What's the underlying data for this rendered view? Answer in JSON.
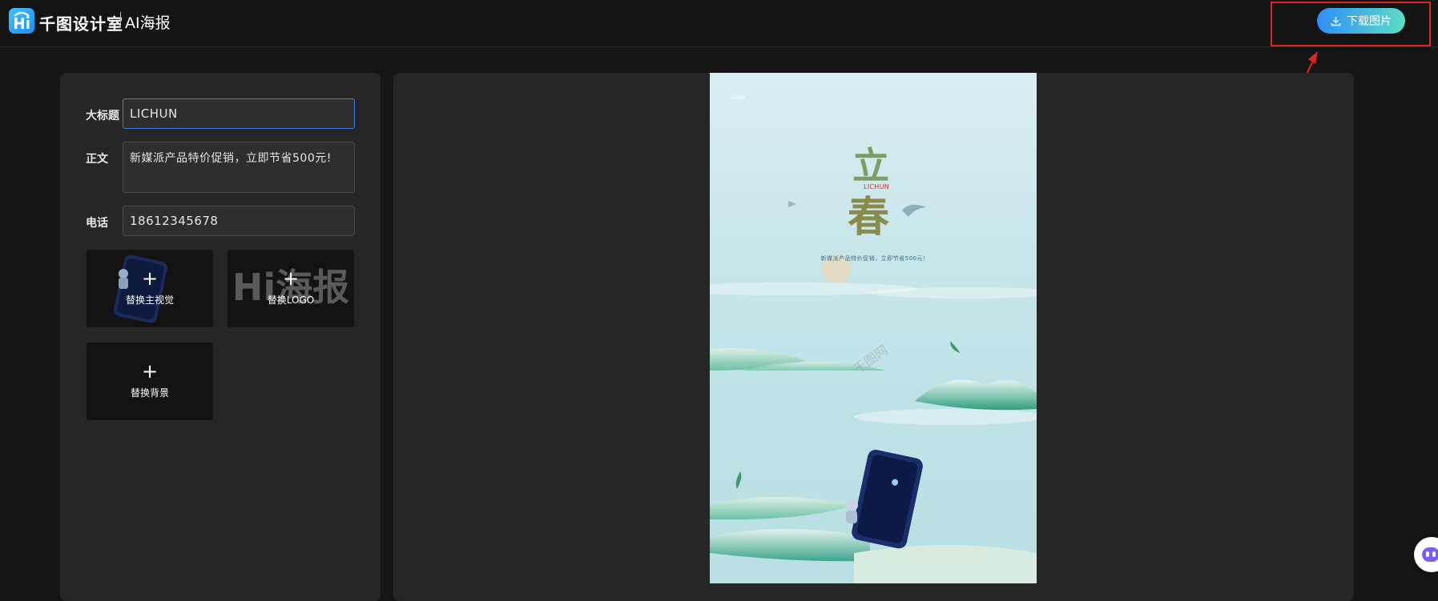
{
  "header": {
    "brand_name": "千图设计室",
    "brand_sub": "AI海报",
    "download_label": "下载图片",
    "logo_icon": "hi-logo-icon"
  },
  "form": {
    "title_label": "大标题",
    "title_value": "LICHUN",
    "body_label": "正文",
    "body_value": "新媒派产品特价促销，立即节省500元!",
    "phone_label": "电话",
    "phone_value": "18612345678"
  },
  "tiles": {
    "main_visual_label": "替换主视觉",
    "logo_label": "替换LOGO",
    "logo_watermark": "Hi海报",
    "background_label": "替换背景",
    "plus": "+"
  },
  "poster": {
    "small_brand": "Hi海报",
    "title_char_1": "立",
    "title_char_2": "春",
    "subtitle": "LICHUN",
    "body": "新媒派产品特价促销，立即节省500元!",
    "watermark": "千图网"
  },
  "colors": {
    "accent": "#3b7fe6",
    "download_gradient_start": "#2d8ff7",
    "download_gradient_end": "#5fdcc6",
    "annotation_red": "#e0241f"
  }
}
